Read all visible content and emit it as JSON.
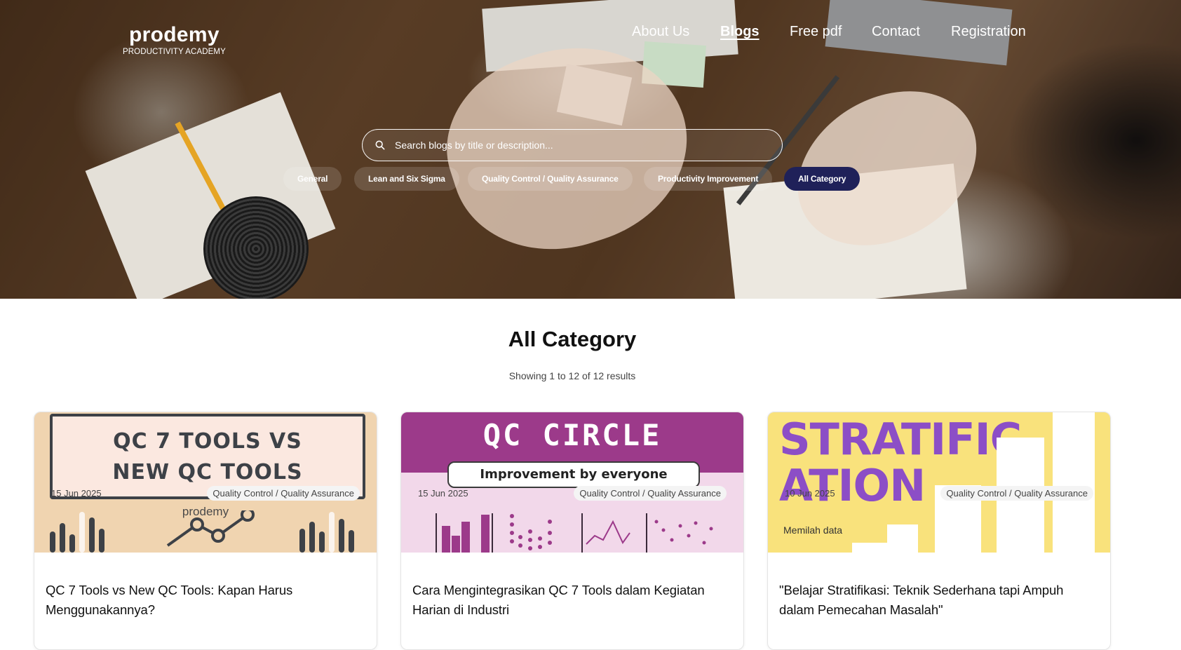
{
  "header": {
    "logo": {
      "name": "prodemy",
      "tagline": "PRODUCTIVITY ACADEMY"
    },
    "nav": [
      {
        "label": "About Us",
        "active": false
      },
      {
        "label": "Blogs",
        "active": true
      },
      {
        "label": "Free pdf",
        "active": false
      },
      {
        "label": "Contact",
        "active": false
      },
      {
        "label": "Registration",
        "active": false
      }
    ]
  },
  "search": {
    "placeholder": "Search blogs by title or description..."
  },
  "categories": [
    {
      "label": "General",
      "active": false
    },
    {
      "label": "Lean and Six Sigma",
      "active": false
    },
    {
      "label": "Quality Control / Quality Assurance",
      "active": false
    },
    {
      "label": "Productivity Improvement",
      "active": false
    },
    {
      "label": "All Category",
      "active": true
    }
  ],
  "main": {
    "title": "All Category",
    "results_text": "Showing 1 to 12 of 12 results"
  },
  "posts": [
    {
      "title": "QC 7 Tools vs New QC Tools: Kapan Harus Menggunakannya?",
      "date": "15 Jun 2025",
      "category": "Quality Control / Quality Assurance",
      "image": {
        "line1": "QC 7 TOOLS VS",
        "line2": "NEW QC TOOLS",
        "brand": "prodemy"
      }
    },
    {
      "title": "Cara Mengintegrasikan QC 7 Tools dalam Kegiatan Harian di Industri",
      "date": "15 Jun 2025",
      "category": "Quality Control / Quality Assurance",
      "image": {
        "title": "QC CIRCLE",
        "subtitle": "Improvement by everyone"
      }
    },
    {
      "title": "\"Belajar Stratifikasi: Teknik Sederhana tapi Ampuh dalam Pemecahan Masalah\"",
      "date": "10 Jun 2025",
      "category": "Quality Control / Quality Assurance",
      "image": {
        "line1": "STRATIFIC",
        "line2": "ATION",
        "note": "Memilah data"
      }
    }
  ],
  "colors": {
    "active_chip": "#1f2159",
    "card2_header": "#9c3a8a",
    "card3_text": "#8c4ec6",
    "card3_bg": "#f9e27c"
  }
}
